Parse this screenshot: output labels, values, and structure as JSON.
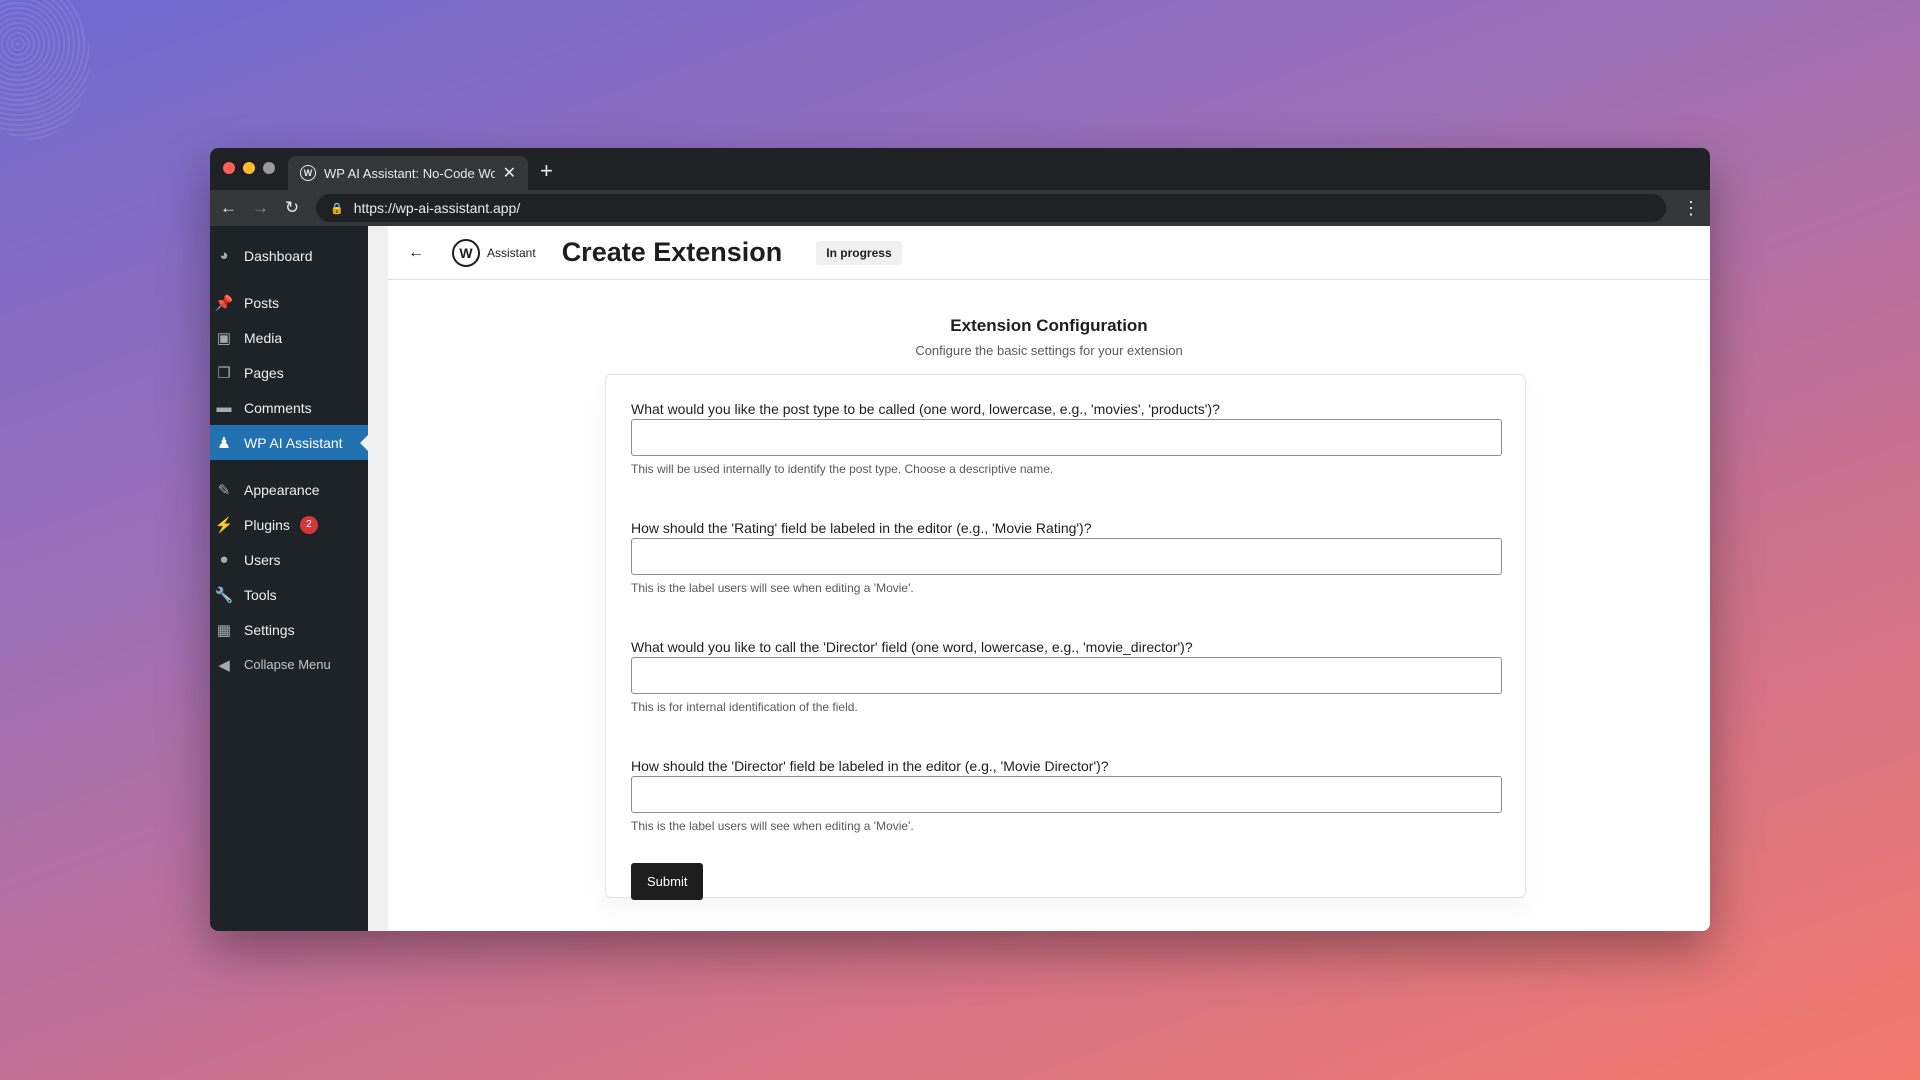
{
  "browser": {
    "tab_title": "WP AI Assistant: No-Code Wor",
    "url": "https://wp-ai-assistant.app/"
  },
  "sidebar": {
    "items": [
      {
        "label": "Dashboard",
        "icon": "dashboard-icon"
      },
      {
        "label": "Posts",
        "icon": "pin-icon"
      },
      {
        "label": "Media",
        "icon": "media-icon"
      },
      {
        "label": "Pages",
        "icon": "pages-icon"
      },
      {
        "label": "Comments",
        "icon": "comments-icon"
      },
      {
        "label": "WP AI Assistant",
        "icon": "assistant-icon",
        "active": true
      },
      {
        "label": "Appearance",
        "icon": "brush-icon"
      },
      {
        "label": "Plugins",
        "icon": "plugin-icon",
        "badge": "2"
      },
      {
        "label": "Users",
        "icon": "users-icon"
      },
      {
        "label": "Tools",
        "icon": "wrench-icon"
      },
      {
        "label": "Settings",
        "icon": "settings-icon"
      },
      {
        "label": "Collapse Menu",
        "icon": "collapse-icon"
      }
    ]
  },
  "header": {
    "logo_text": "Assistant",
    "title": "Create Extension",
    "status": "In progress"
  },
  "section": {
    "title": "Extension Configuration",
    "subtitle": "Configure the basic settings for your extension"
  },
  "form": {
    "fields": [
      {
        "label": "What would you like the post type to be called (one word, lowercase, e.g., 'movies', 'products')?",
        "value": "",
        "help": "This will be used internally to identify the post type. Choose a descriptive name."
      },
      {
        "label": "How should the 'Rating' field be labeled in the editor (e.g., 'Movie Rating')?",
        "value": "",
        "help": "This is the label users will see when editing a 'Movie'."
      },
      {
        "label": "What would you like to call the 'Director' field (one word, lowercase, e.g., 'movie_director')?",
        "value": "",
        "help": "This is for internal identification of the field."
      },
      {
        "label": "How should the 'Director' field be labeled in the editor (e.g., 'Movie Director')?",
        "value": "",
        "help": "This is the label users will see when editing a 'Movie'."
      }
    ],
    "submit_label": "Submit"
  },
  "colors": {
    "sidebar_bg": "#1d2327",
    "active_item": "#2271b1",
    "badge": "#d63638",
    "button": "#1e1e1e"
  }
}
